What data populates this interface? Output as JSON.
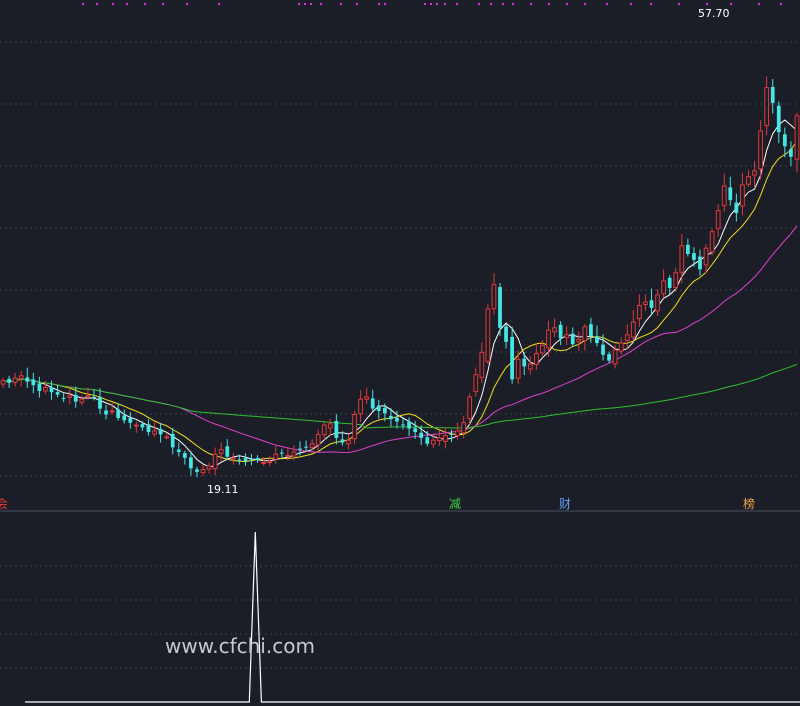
{
  "colors": {
    "background": "#1b1e27",
    "up": "#e0393b",
    "down": "#45e6e6",
    "ma_short": "#ffffff",
    "ma_mid": "#f0e020",
    "ma_long": "#e040d0",
    "ma_longest": "#30c030",
    "grid": "#3c4150",
    "markers": "#e030e0",
    "indicator": "#ffffff"
  },
  "labels": {
    "high_price": "57.70",
    "low_price": "19.11",
    "watermark": "www.cfchi.com"
  },
  "events": [
    {
      "text": "减",
      "color": "#40d040"
    },
    {
      "text": "财",
      "color": "#60a0ff"
    },
    {
      "text": "榜",
      "color": "#f0a040"
    }
  ],
  "chart_data": [
    {
      "type": "candlestick",
      "title": "",
      "grid": true,
      "ylim": [
        17,
        59
      ],
      "x_count": 132,
      "high": 57.7,
      "low": 19.11,
      "closes": [
        27.2,
        27.0,
        27.4,
        27.6,
        27.1,
        26.8,
        26.3,
        26.6,
        26.2,
        26.0,
        25.7,
        25.9,
        25.4,
        25.6,
        25.9,
        25.8,
        24.8,
        24.3,
        24.6,
        24.0,
        23.8,
        23.6,
        23.4,
        23.2,
        22.8,
        22.9,
        22.6,
        22.4,
        21.5,
        21.1,
        20.6,
        19.7,
        19.4,
        19.6,
        19.9,
        20.9,
        21.3,
        20.7,
        20.6,
        20.4,
        20.3,
        20.5,
        20.4,
        20.2,
        20.3,
        20.9,
        21.0,
        20.8,
        21.1,
        21.3,
        21.5,
        21.8,
        22.6,
        23.4,
        23.5,
        22.3,
        21.9,
        22.1,
        24.3,
        25.6,
        25.8,
        24.8,
        24.6,
        24.4,
        23.9,
        23.7,
        23.4,
        23.1,
        22.8,
        22.3,
        21.8,
        22.1,
        22.3,
        22.5,
        22.6,
        22.9,
        23.6,
        25.8,
        27.7,
        29.6,
        33.3,
        35.4,
        31.7,
        30.5,
        27.3,
        29.0,
        28.4,
        28.6,
        29.5,
        30.2,
        31.5,
        31.7,
        30.8,
        31.1,
        30.3,
        30.7,
        31.8,
        31.0,
        30.4,
        29.4,
        28.9,
        29.8,
        30.4,
        31.1,
        32.2,
        33.6,
        33.9,
        33.4,
        34.5,
        35.7,
        35.1,
        36.4,
        38.7,
        38.0,
        37.5,
        36.7,
        38.5,
        39.9,
        41.7,
        43.8,
        42.6,
        41.5,
        43.9,
        44.6,
        45.1,
        48.5,
        52.2,
        50.9,
        48.4,
        47.2,
        46.3,
        49.8
      ],
      "ma_periods": [
        5,
        10,
        30,
        120
      ]
    },
    {
      "type": "line",
      "title": "",
      "series": [
        {
          "values": [
            0,
            0,
            0,
            0,
            0,
            0,
            0,
            0,
            0,
            0,
            0,
            0,
            0,
            0,
            0,
            0,
            0,
            0,
            0,
            0,
            0,
            0,
            0,
            0,
            0,
            0,
            0,
            0,
            0,
            0,
            0,
            0,
            0,
            0,
            0,
            0,
            0,
            0,
            1,
            0,
            0,
            0,
            0,
            0,
            0,
            0,
            0,
            0,
            0,
            0,
            0,
            0,
            0,
            0,
            0,
            0,
            0,
            0,
            0,
            0,
            0,
            0,
            0,
            0,
            0,
            0,
            0,
            0,
            0,
            0,
            0,
            0,
            0,
            0,
            0,
            0,
            0,
            0,
            0,
            0,
            0,
            0,
            0,
            0,
            0,
            0,
            0,
            0,
            0,
            0,
            0,
            0,
            0,
            0,
            0,
            0,
            0,
            0,
            0,
            0,
            0,
            0,
            0,
            0,
            0,
            0,
            0,
            0,
            0,
            0,
            0,
            0,
            0,
            0,
            0,
            0,
            0,
            0,
            0,
            0,
            0,
            0,
            0,
            0,
            0,
            0,
            0,
            0,
            0,
            0,
            0,
            0
          ]
        }
      ],
      "ylim": [
        0,
        1
      ]
    }
  ]
}
